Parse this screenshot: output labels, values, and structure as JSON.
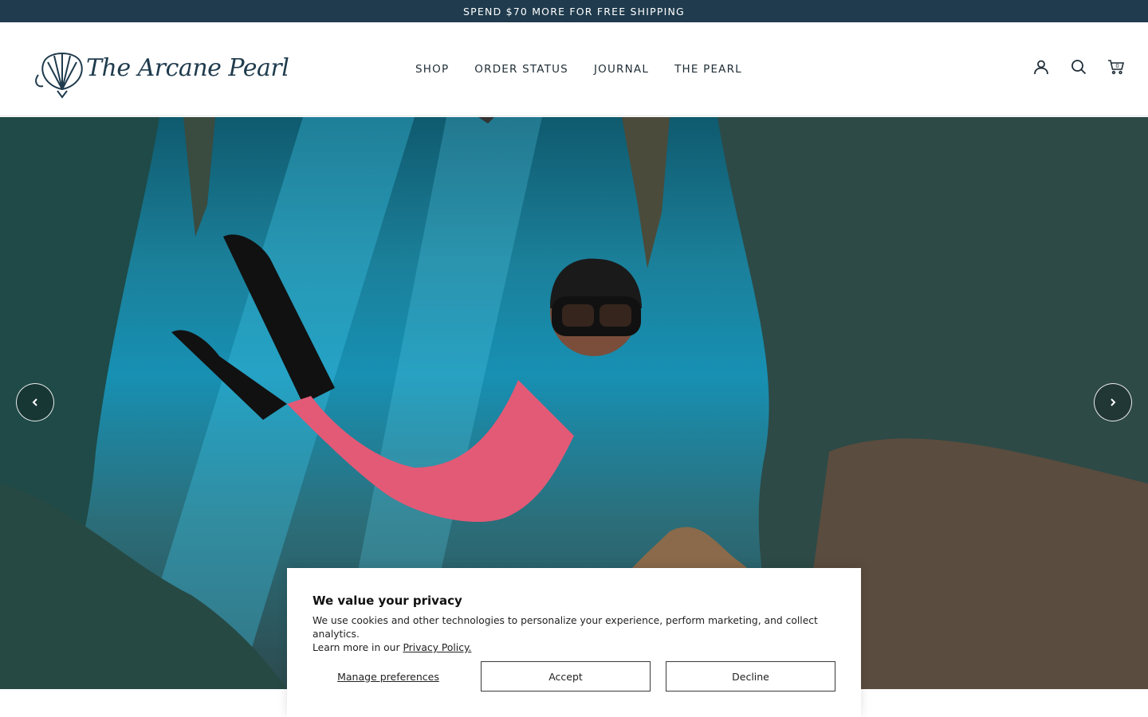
{
  "announcement": {
    "text": "SPEND $70 MORE FOR FREE SHIPPING"
  },
  "header": {
    "logo_text": "The Arcane Pearl",
    "nav": [
      {
        "label": "SHOP"
      },
      {
        "label": "ORDER STATUS"
      },
      {
        "label": "JOURNAL"
      },
      {
        "label": "THE PEARL"
      }
    ],
    "icons": [
      "account-icon",
      "search-icon",
      "cart-icon"
    ],
    "cart_count": "0"
  },
  "hero": {
    "prev_icon": "chevron-left-icon",
    "next_icon": "chevron-right-icon"
  },
  "cookie_banner": {
    "title": "We value your privacy",
    "body_line1": "We use cookies and other technologies to personalize your experience, perform marketing, and collect analytics.",
    "body_line2_prefix": "Learn more in our ",
    "privacy_link": "Privacy Policy.",
    "manage_label": "Manage preferences",
    "accept_label": "Accept",
    "decline_label": "Decline"
  },
  "colors": {
    "announcement_bg": "#1f3b4d",
    "brand": "#1f3b4d"
  }
}
